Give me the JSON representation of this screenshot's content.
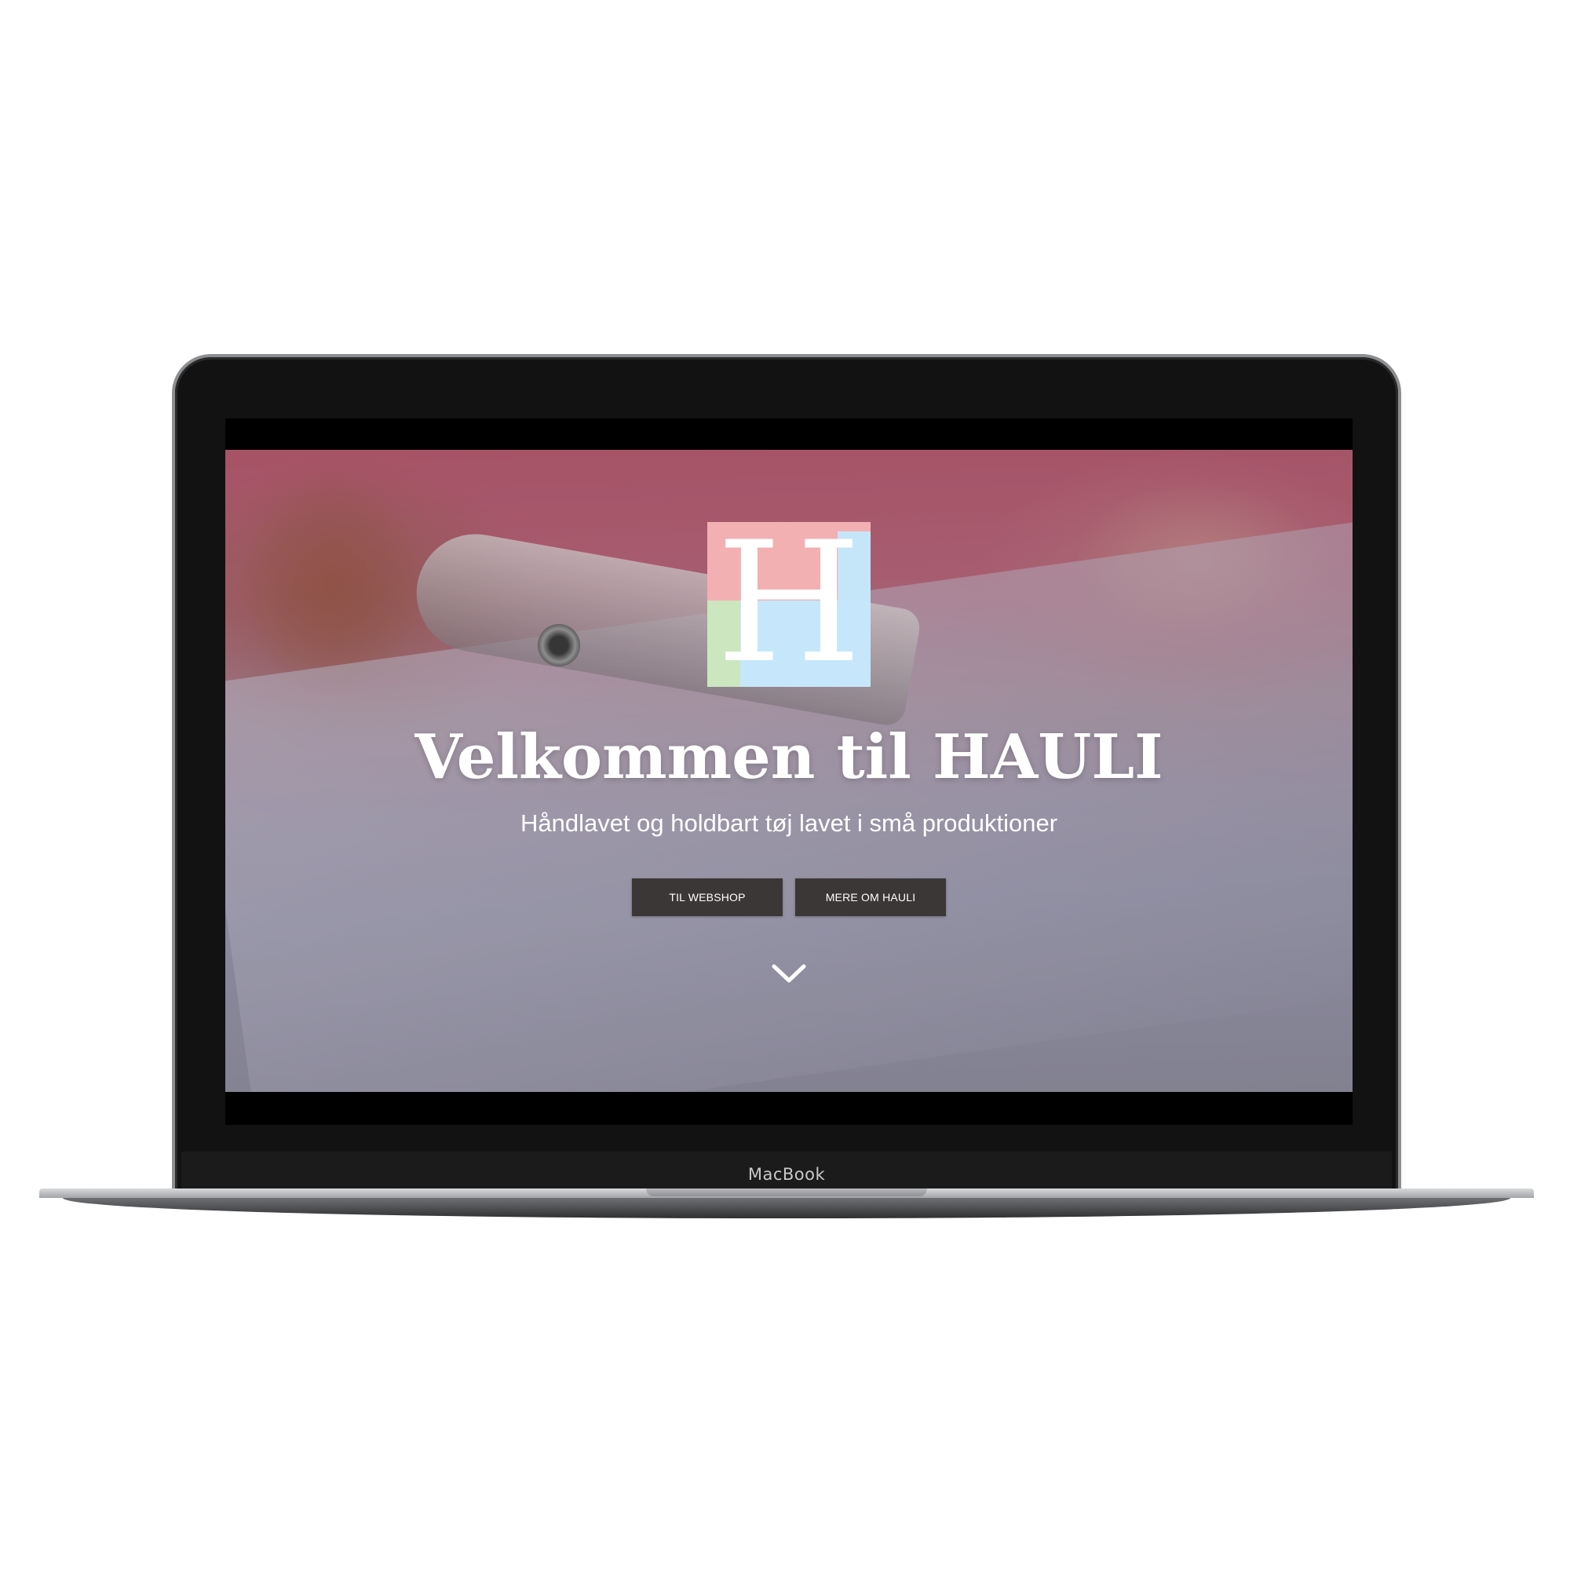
{
  "device": {
    "brand_label": "MacBook"
  },
  "hero": {
    "logo_letter": "H",
    "title": "Velkommen til HAULI",
    "subtitle": "Håndlavet og holdbart tøj lavet i små produktioner",
    "buttons": {
      "webshop_label": "TIL WEBSHOP",
      "about_label": "MERE OM HAULI"
    },
    "scroll_icon": "chevron-down-icon"
  },
  "colors": {
    "logo_pink": "#f2b0b3",
    "logo_blue": "#c6e7fb",
    "logo_green": "#cce6bf",
    "button_bg": "#3c3737"
  }
}
